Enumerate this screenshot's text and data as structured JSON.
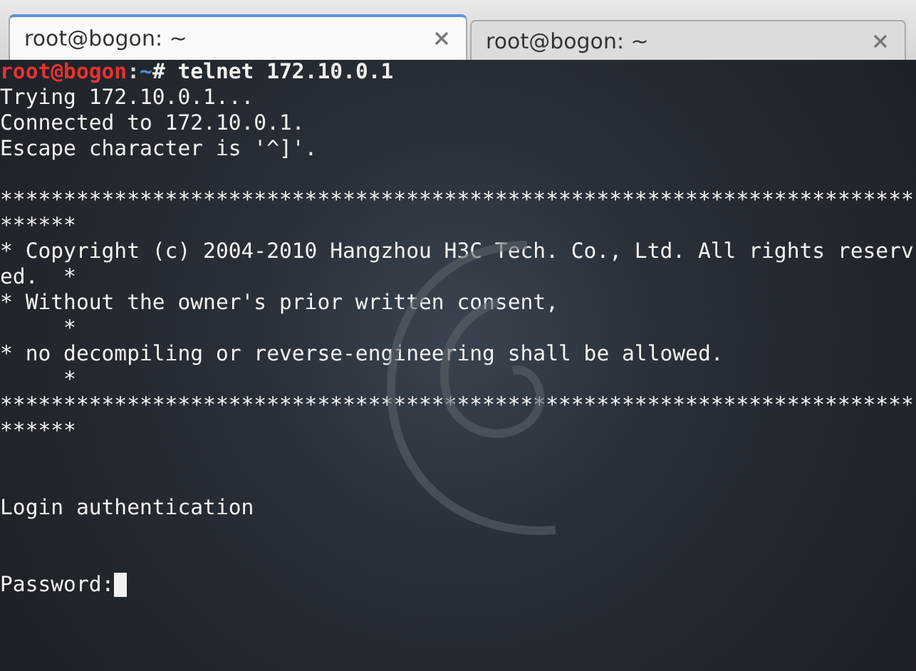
{
  "tabs": [
    {
      "label": "root@bogon: ~",
      "selected": true
    },
    {
      "label": "root@bogon: ~",
      "selected": false
    }
  ],
  "terminal": {
    "cursor_visible": true,
    "lines": [
      {
        "kind": "prompt",
        "parts": [
          {
            "text": "root@bogon",
            "color": "#e8332e"
          },
          {
            "text": ":",
            "color": "#d8d8d8"
          },
          {
            "text": "~",
            "color": "#4a8fd9"
          },
          {
            "text": "# telnet 172.10.0.1",
            "color": "#f0f0f0"
          }
        ]
      },
      {
        "kind": "output",
        "text": "Trying 172.10.0.1..."
      },
      {
        "kind": "output",
        "text": "Connected to 172.10.0.1."
      },
      {
        "kind": "output",
        "text": "Escape character is '^]'."
      },
      {
        "kind": "blank"
      },
      {
        "kind": "output",
        "text": "******************************************************************************"
      },
      {
        "kind": "output",
        "text": "* Copyright (c) 2004-2010 Hangzhou H3C Tech. Co., Ltd. All rights reserved.  *"
      },
      {
        "kind": "output",
        "text": "* Without the owner's prior written consent,                                 *"
      },
      {
        "kind": "output",
        "text": "* no decompiling or reverse-engineering shall be allowed.                    *"
      },
      {
        "kind": "output",
        "text": "******************************************************************************"
      },
      {
        "kind": "blank"
      },
      {
        "kind": "blank"
      },
      {
        "kind": "output",
        "text": "Login authentication"
      },
      {
        "kind": "blank"
      },
      {
        "kind": "blank"
      },
      {
        "kind": "output",
        "text": "Password:",
        "cursor": true
      }
    ]
  }
}
